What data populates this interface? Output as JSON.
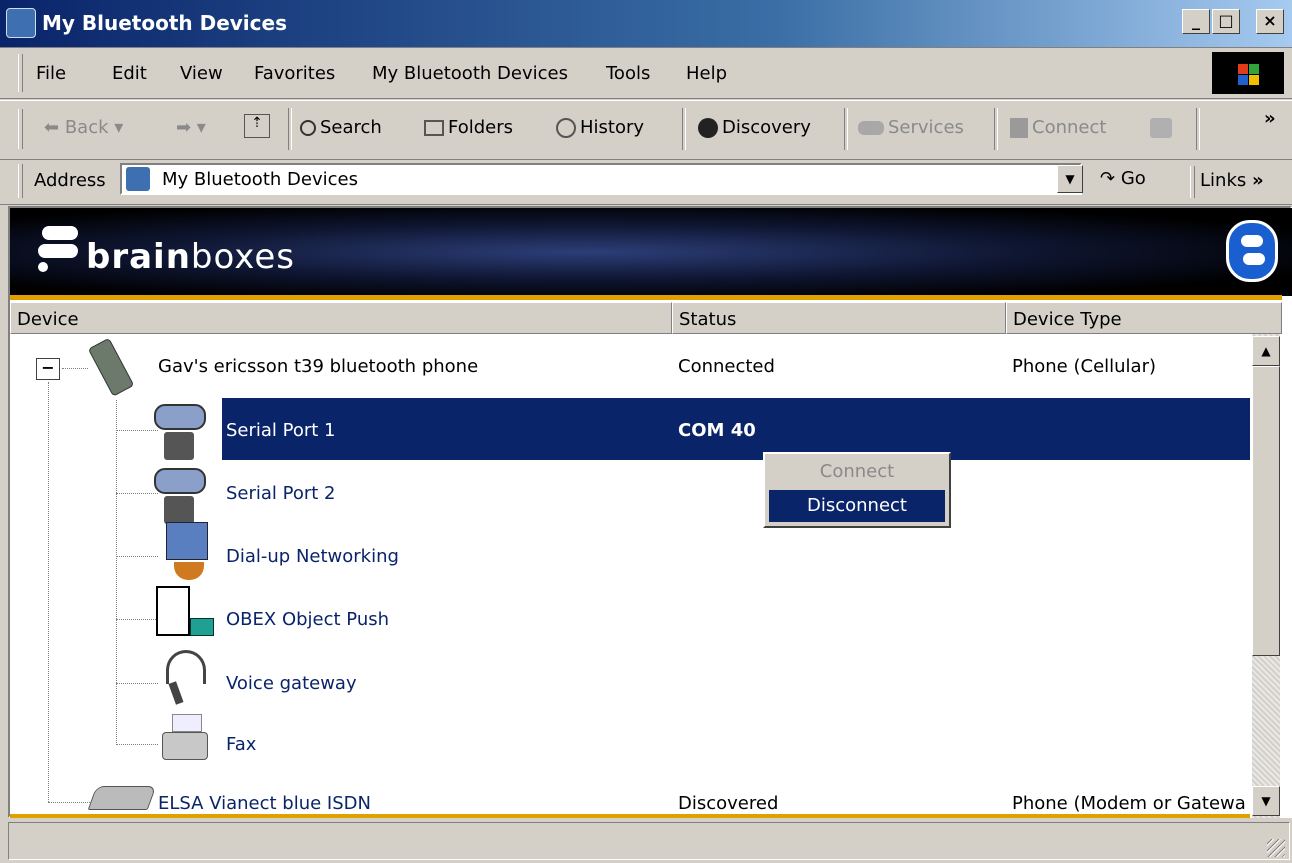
{
  "window": {
    "title": "My Bluetooth Devices",
    "min": "_",
    "max": "□",
    "close": "×"
  },
  "menu": [
    "File",
    "Edit",
    "View",
    "Favorites",
    "My Bluetooth Devices",
    "Tools",
    "Help"
  ],
  "toolbar": {
    "back": "Back",
    "search": "Search",
    "folders": "Folders",
    "history": "History",
    "discovery": "Discovery",
    "services": "Services",
    "connect": "Connect",
    "more": "»"
  },
  "address": {
    "label": "Address",
    "value": "My Bluetooth Devices",
    "go": "Go",
    "links": "Links",
    "links_more": "»"
  },
  "banner": {
    "brand_bold": "brain",
    "brand_light": "boxes"
  },
  "columns": {
    "device": "Device",
    "status": "Status",
    "type": "Device Type"
  },
  "devices": [
    {
      "name": "Gav's ericsson t39 bluetooth phone",
      "status": "Connected",
      "type": "Phone (Cellular)",
      "expander": "−"
    },
    {
      "name": "ELSA Vianect blue ISDN",
      "status": "Discovered",
      "type": "Phone (Modem or Gatewa"
    }
  ],
  "services": [
    {
      "name": "Serial Port 1",
      "status": "COM 40"
    },
    {
      "name": "Serial Port 2"
    },
    {
      "name": "Dial-up Networking"
    },
    {
      "name": "OBEX Object Push"
    },
    {
      "name": "Voice gateway"
    },
    {
      "name": "Fax"
    }
  ],
  "context_menu": {
    "connect": "Connect",
    "disconnect": "Disconnect"
  },
  "colors": {
    "selection": "#0a246a",
    "banner_accent": "#e0a000",
    "face": "#d4d0c8"
  }
}
